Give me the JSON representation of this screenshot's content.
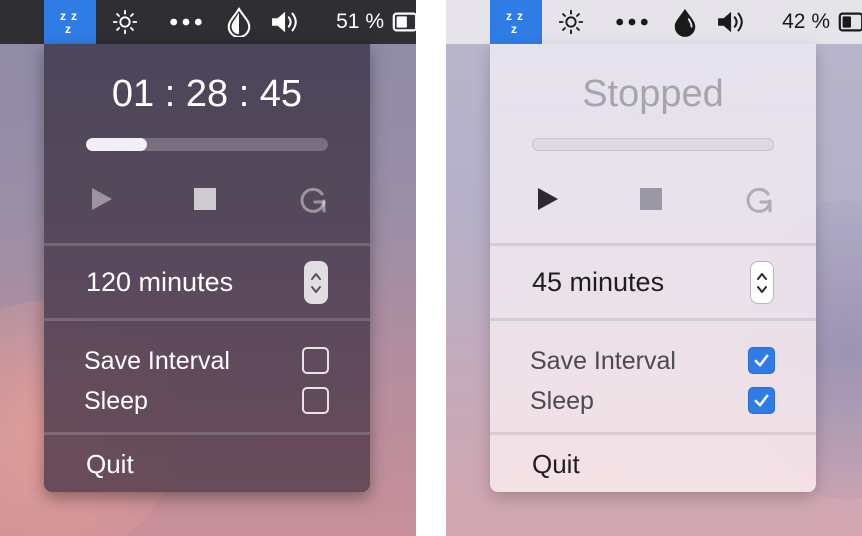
{
  "screenshots": [
    {
      "theme": "dark",
      "menubar": {
        "icons": [
          "sleep-zzz-icon",
          "brightness-icon",
          "more-icon",
          "drop-icon",
          "volume-icon",
          "battery-icon"
        ],
        "battery_text": "51 %"
      },
      "popup": {
        "timer_text": "01 : 28 : 45",
        "progress": 0.25,
        "duration_text": "120 minutes",
        "options": [
          {
            "label": "Save Interval",
            "checked": false
          },
          {
            "label": "Sleep",
            "checked": false
          }
        ],
        "quit_label": "Quit"
      }
    },
    {
      "theme": "light",
      "menubar": {
        "icons": [
          "sleep-zzz-icon",
          "brightness-icon",
          "more-icon",
          "drop-icon",
          "volume-icon",
          "battery-icon"
        ],
        "battery_text": "42 %"
      },
      "popup": {
        "timer_text": "Stopped",
        "progress": 0,
        "duration_text": "45 minutes",
        "options": [
          {
            "label": "Save Interval",
            "checked": true
          },
          {
            "label": "Sleep",
            "checked": true
          }
        ],
        "quit_label": "Quit"
      }
    }
  ],
  "colors": {
    "accent": "#2f7ce6",
    "dark_menubar": "#2e2e33",
    "light_menubar": "#e6e4ea"
  }
}
